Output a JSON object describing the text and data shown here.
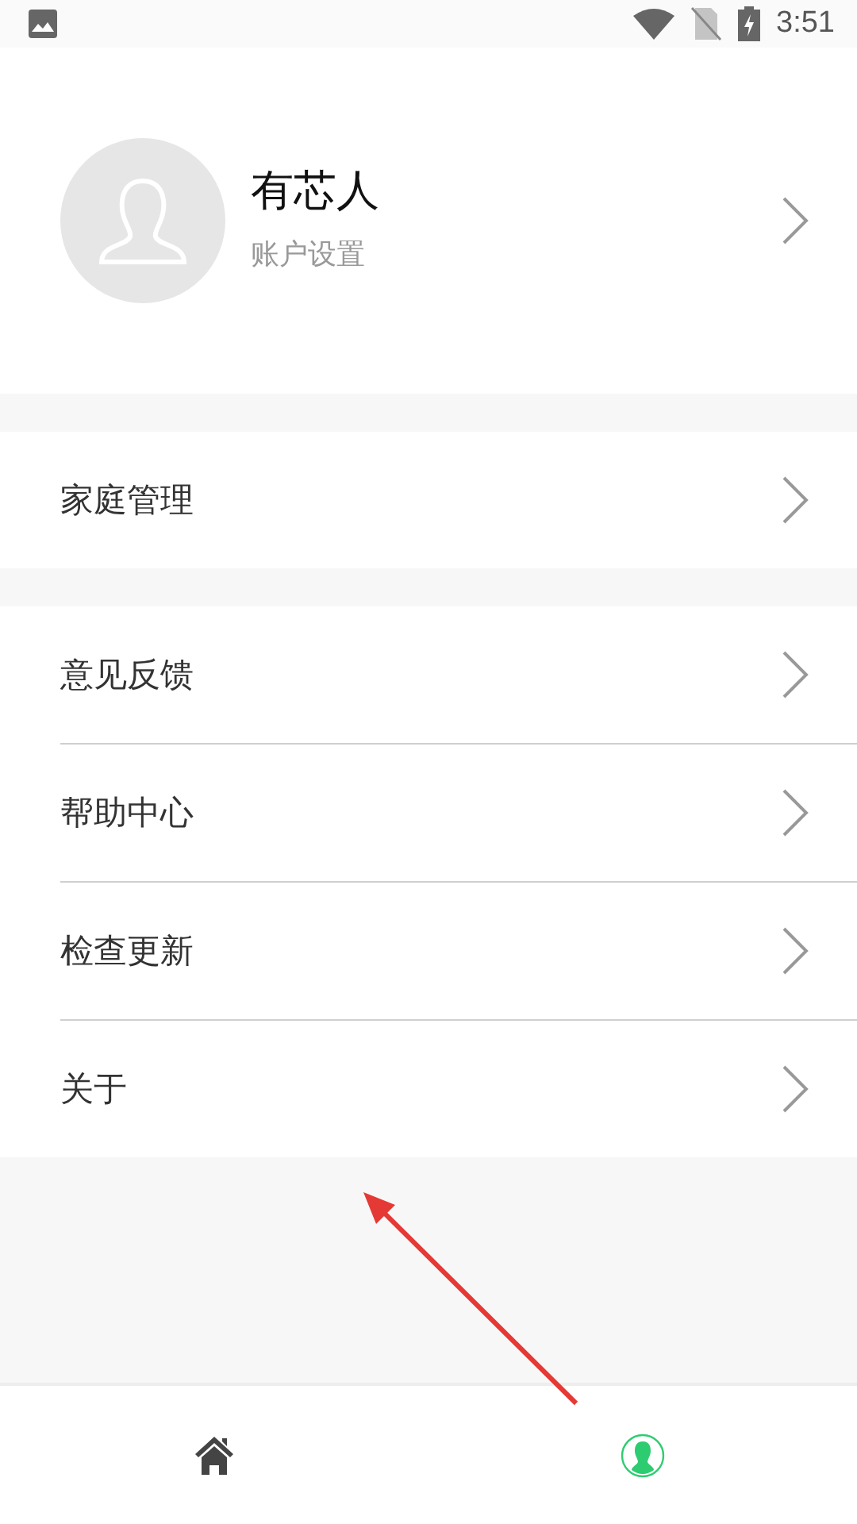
{
  "status_bar": {
    "time": "3:51"
  },
  "profile": {
    "name": "有芯人",
    "subtitle": "账户设置"
  },
  "groups": [
    {
      "items": [
        {
          "label": "家庭管理"
        }
      ]
    },
    {
      "items": [
        {
          "label": "意见反馈"
        },
        {
          "label": "帮助中心"
        },
        {
          "label": "检查更新"
        },
        {
          "label": "关于"
        }
      ]
    }
  ],
  "bottom_nav": [
    {
      "kind": "home",
      "selected": false
    },
    {
      "kind": "profile",
      "selected": true
    }
  ]
}
